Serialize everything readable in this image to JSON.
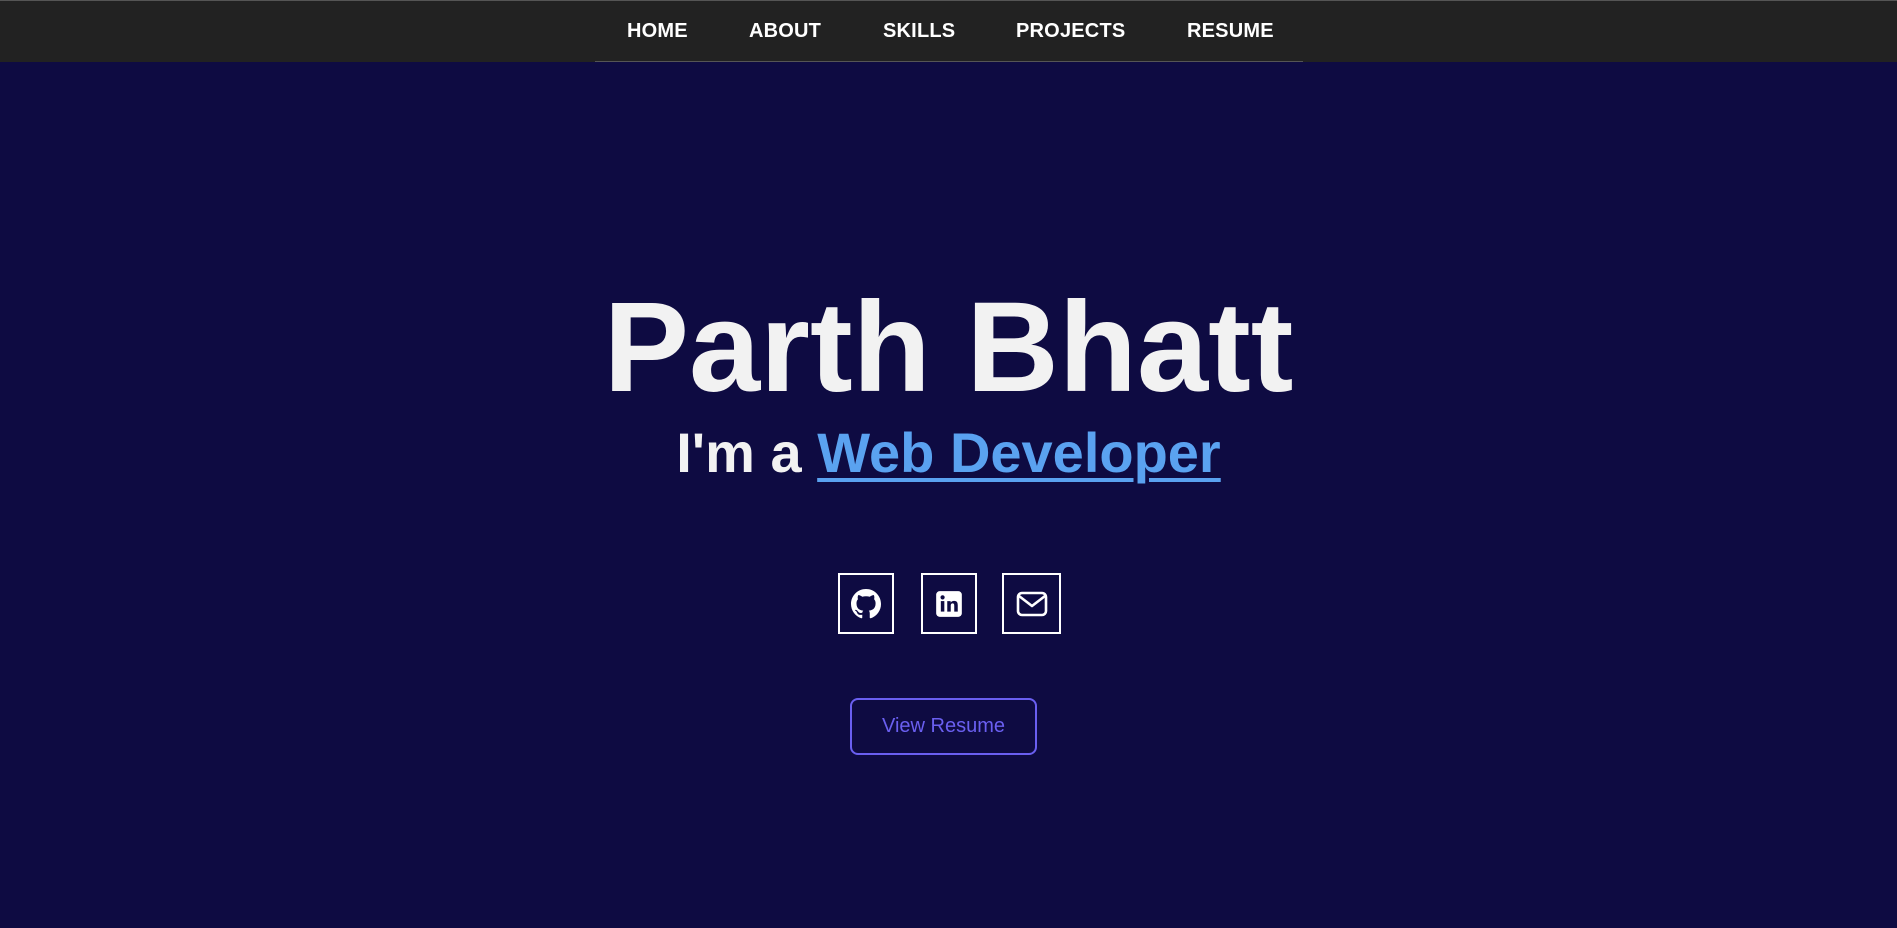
{
  "nav": {
    "items": [
      {
        "label": "HOME"
      },
      {
        "label": "ABOUT"
      },
      {
        "label": "SKILLS"
      },
      {
        "label": "PROJECTS"
      },
      {
        "label": "RESUME"
      }
    ]
  },
  "hero": {
    "name": "Parth Bhatt",
    "prefix": "I'm a ",
    "role": "Web Developer"
  },
  "social": {
    "icons": [
      "github-icon",
      "linkedin-icon",
      "mail-icon"
    ]
  },
  "cta": {
    "label": "View Resume"
  },
  "colors": {
    "background": "#0e0b42",
    "navbar": "#222222",
    "text": "#f2f2f2",
    "accent_link": "#5aa2f0",
    "button_accent": "#6a5ff0"
  }
}
